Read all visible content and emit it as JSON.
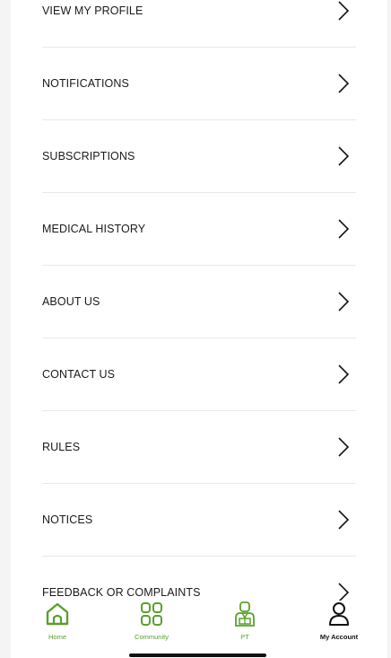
{
  "menu": {
    "items": [
      {
        "label": "VIEW MY PROFILE"
      },
      {
        "label": "NOTIFICATIONS"
      },
      {
        "label": "SUBSCRIPTIONS"
      },
      {
        "label": "MEDICAL HISTORY"
      },
      {
        "label": "ABOUT US"
      },
      {
        "label": "CONTACT US"
      },
      {
        "label": "RULES"
      },
      {
        "label": "NOTICES"
      },
      {
        "label": "FEEDBACK OR COMPLAINTS"
      }
    ]
  },
  "tabbar": {
    "tabs": [
      {
        "label": "Home",
        "icon": "home-icon"
      },
      {
        "label": "Community",
        "icon": "community-icon"
      },
      {
        "label": "PT",
        "icon": "trainer-icon"
      },
      {
        "label": "My Account",
        "icon": "account-icon",
        "active": true
      }
    ]
  },
  "colors": {
    "accent": "#5aa02c",
    "active_tab": "#111111",
    "divider": "#e8e8e8"
  }
}
